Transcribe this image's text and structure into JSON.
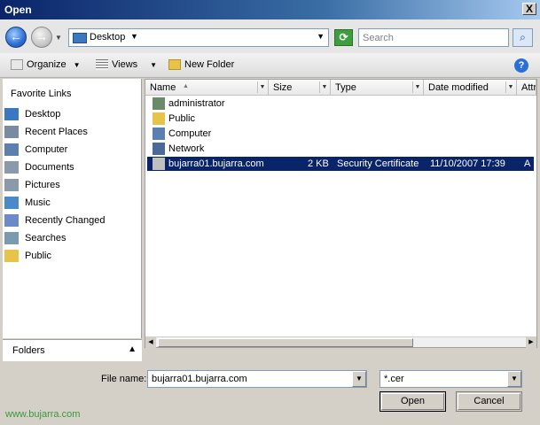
{
  "window": {
    "title": "Open",
    "close_glyph": "X"
  },
  "nav": {
    "back_glyph": "←",
    "forward_glyph": "→",
    "address": "Desktop",
    "search_placeholder": "Search"
  },
  "toolbar": {
    "organize": "Organize",
    "views": "Views",
    "new_folder": "New Folder",
    "help_glyph": "?"
  },
  "sidebar": {
    "title": "Favorite Links",
    "items": [
      {
        "label": "Desktop",
        "icon": "desktop-icon",
        "color": "#3a78c2"
      },
      {
        "label": "Recent Places",
        "icon": "recent-places-icon",
        "color": "#7a8aa0"
      },
      {
        "label": "Computer",
        "icon": "computer-icon",
        "color": "#5a7fb0"
      },
      {
        "label": "Documents",
        "icon": "documents-icon",
        "color": "#8a9aaa"
      },
      {
        "label": "Pictures",
        "icon": "pictures-icon",
        "color": "#8a9aaa"
      },
      {
        "label": "Music",
        "icon": "music-icon",
        "color": "#4a8ac8"
      },
      {
        "label": "Recently Changed",
        "icon": "recently-changed-icon",
        "color": "#6a8ac8"
      },
      {
        "label": "Searches",
        "icon": "searches-icon",
        "color": "#7a9ab0"
      },
      {
        "label": "Public",
        "icon": "folder-icon",
        "color": "#e8c34a"
      }
    ],
    "folders_label": "Folders"
  },
  "columns": {
    "name": "Name",
    "size": "Size",
    "type": "Type",
    "date_modified": "Date modified",
    "attributes": "Attr"
  },
  "files": [
    {
      "name": "administrator",
      "icon": "user-folder-icon",
      "color": "#6a8a6a"
    },
    {
      "name": "Public",
      "icon": "folder-icon",
      "color": "#e8c34a"
    },
    {
      "name": "Computer",
      "icon": "computer-icon",
      "color": "#5a7fb0"
    },
    {
      "name": "Network",
      "icon": "network-icon",
      "color": "#4a6a9a"
    },
    {
      "name": "bujarra01.bujarra.com",
      "icon": "certificate-icon",
      "color": "#c0c0c0",
      "size": "2 KB",
      "type": "Security Certificate",
      "date": "11/10/2007 17:39",
      "attr": "A"
    }
  ],
  "bottom": {
    "file_name_label": "File name:",
    "file_name_value": "bujarra01.bujarra.com",
    "filter_value": "*.cer",
    "open_label": "Open",
    "cancel_label": "Cancel"
  },
  "watermark": "www.bujarra.com",
  "colors": {
    "selection": "#0a246a",
    "titlebar": "#0a246a"
  }
}
